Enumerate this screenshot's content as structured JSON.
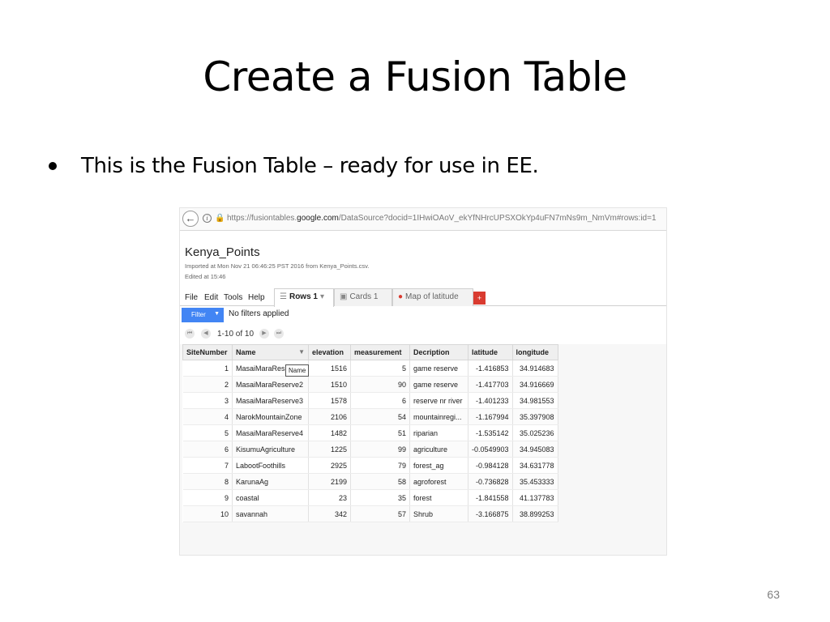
{
  "slide": {
    "title": "Create a Fusion Table",
    "bullet": "This is the Fusion Table – ready for use in EE.",
    "page_number": "63"
  },
  "browser": {
    "back_icon": "back-arrow-icon",
    "url_prefix": "https://fusiontables.",
    "url_domain": "google.com",
    "url_suffix": "/DataSource?docid=1IHwiOAoV_ekYfNHrcUPSXOkYp4uFN7mNs9m_NmVm#rows:id=1"
  },
  "doc": {
    "title": "Kenya_Points",
    "imported": "Imported at Mon Nov 21 06:46:25 PST 2016 from Kenya_Points.csv.",
    "edited": "Edited at 15:46"
  },
  "menu": {
    "file": "File",
    "edit": "Edit",
    "tools": "Tools",
    "help": "Help"
  },
  "tabs": {
    "rows": "Rows 1",
    "cards": "Cards 1",
    "map": "Map of latitude",
    "add": "+"
  },
  "filter": {
    "button": "Filter",
    "status": "No filters applied"
  },
  "pager": {
    "label": "1-10 of 10"
  },
  "table": {
    "headers": [
      "SiteNumber",
      "Name",
      "elevation",
      "measurement",
      "Decription",
      "latitude",
      "longitude"
    ],
    "tooltip": "Name",
    "rows": [
      [
        "1",
        "MasaiMaraReserve1",
        "1516",
        "5",
        "game reserve",
        "-1.416853",
        "34.914683"
      ],
      [
        "2",
        "MasaiMaraReserve2",
        "1510",
        "90",
        "game reserve",
        "-1.417703",
        "34.916669"
      ],
      [
        "3",
        "MasaiMaraReserve3",
        "1578",
        "6",
        "reserve nr river",
        "-1.401233",
        "34.981553"
      ],
      [
        "4",
        "NarokMountainZone",
        "2106",
        "54",
        "mountainregi...",
        "-1.167994",
        "35.397908"
      ],
      [
        "5",
        "MasaiMaraReserve4",
        "1482",
        "51",
        "riparian",
        "-1.535142",
        "35.025236"
      ],
      [
        "6",
        "KisumuAgriculture",
        "1225",
        "99",
        "agriculture",
        "-0.0549903",
        "34.945083"
      ],
      [
        "7",
        "LabootFoothills",
        "2925",
        "79",
        "forest_ag",
        "-0.984128",
        "34.631778"
      ],
      [
        "8",
        "KarunaAg",
        "2199",
        "58",
        "agroforest",
        "-0.736828",
        "35.453333"
      ],
      [
        "9",
        "coastal",
        "23",
        "35",
        "forest",
        "-1.841558",
        "41.137783"
      ],
      [
        "10",
        "savannah",
        "342",
        "57",
        "Shrub",
        "-3.166875",
        "38.899253"
      ]
    ]
  }
}
